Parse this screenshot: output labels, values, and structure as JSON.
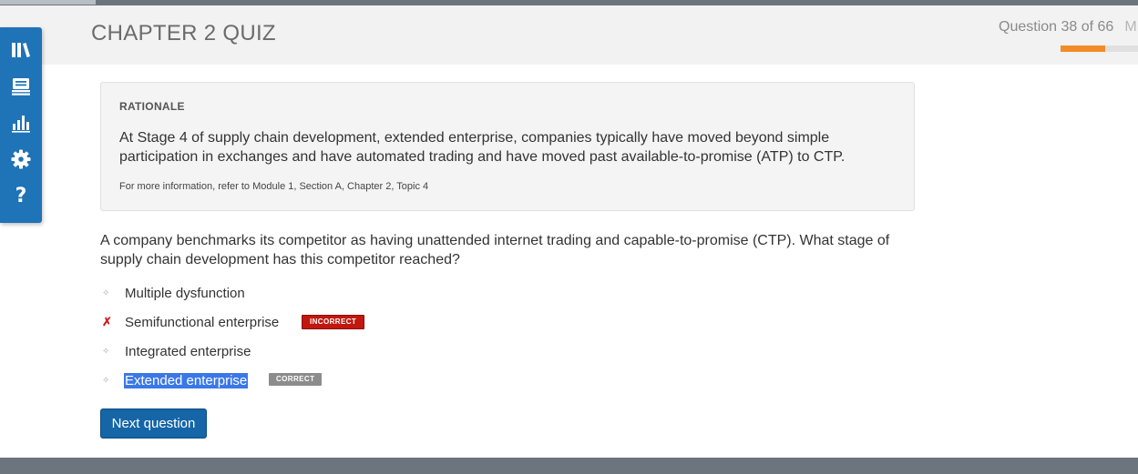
{
  "header": {
    "quiz_title": "CHAPTER 2 QUIZ",
    "question_counter": "Question 38 of 66",
    "counter_trail": "M",
    "progress_fraction": 0.576,
    "progress_color": "#f28c28"
  },
  "toolbar": {
    "items": [
      {
        "icon": "library-icon"
      },
      {
        "icon": "flashcards-icon"
      },
      {
        "icon": "bar-chart-icon"
      },
      {
        "icon": "gear-icon"
      },
      {
        "icon": "help-icon",
        "glyph": "?"
      }
    ],
    "color": "#1f73b7"
  },
  "rationale": {
    "title": "RATIONALE",
    "text": "At Stage 4 of supply chain development, extended enterprise, companies typically have moved beyond simple participation in exchanges and have automated trading and have moved past available-to-promise (ATP) to CTP.",
    "reference": "For more information, refer to Module 1, Section A, Chapter 2, Topic 4"
  },
  "question": {
    "text": "A company benchmarks its competitor as having unattended internet trading and capable-to-promise (CTP). What stage of supply chain development has this competitor reached?"
  },
  "answers": [
    {
      "label": "Multiple dysfunction",
      "marker": "✧"
    },
    {
      "label": "Semifunctional enterprise",
      "marker": "✗",
      "badge": "INCORRECT"
    },
    {
      "label": "Integrated enterprise",
      "marker": "✧"
    },
    {
      "label": "Extended enterprise",
      "marker": "✧",
      "badge": "CORRECT",
      "selected": true
    }
  ],
  "actions": {
    "next_label": "Next question"
  }
}
